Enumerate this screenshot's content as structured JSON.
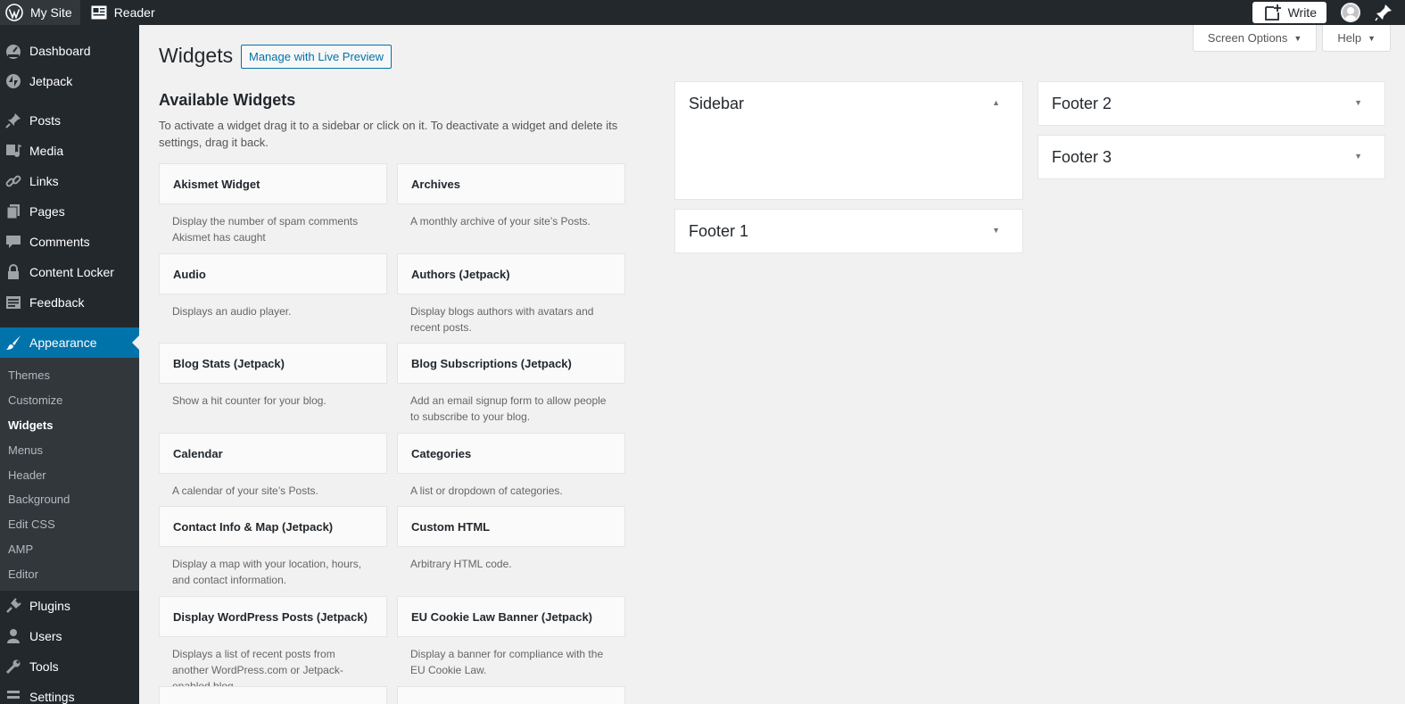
{
  "topbar": {
    "site_label": "My Site",
    "reader_label": "Reader",
    "write_label": "Write"
  },
  "sidebar": {
    "items_top": [
      {
        "label": "Dashboard",
        "icon": "dashboard-icon"
      },
      {
        "label": "Jetpack",
        "icon": "jetpack-icon"
      }
    ],
    "items_mid": [
      {
        "label": "Posts",
        "icon": "pin-icon"
      },
      {
        "label": "Media",
        "icon": "media-icon"
      },
      {
        "label": "Links",
        "icon": "link-icon"
      },
      {
        "label": "Pages",
        "icon": "pages-icon"
      },
      {
        "label": "Comments",
        "icon": "comment-icon"
      },
      {
        "label": "Content Locker",
        "icon": "lock-icon"
      },
      {
        "label": "Feedback",
        "icon": "feedback-icon"
      }
    ],
    "current": {
      "label": "Appearance",
      "icon": "paintbrush-icon"
    },
    "submenu": [
      "Themes",
      "Customize",
      "Widgets",
      "Menus",
      "Header",
      "Background",
      "Edit CSS",
      "AMP",
      "Editor"
    ],
    "submenu_current": "Widgets",
    "items_bottom": [
      {
        "label": "Plugins",
        "icon": "plugin-icon"
      },
      {
        "label": "Users",
        "icon": "user-icon"
      },
      {
        "label": "Tools",
        "icon": "wrench-icon"
      },
      {
        "label": "Settings",
        "icon": "settings-icon"
      }
    ]
  },
  "screen_meta": {
    "screen_options_label": "Screen Options",
    "help_label": "Help"
  },
  "page": {
    "title": "Widgets",
    "live_preview_label": "Manage with Live Preview",
    "available_title": "Available Widgets",
    "available_desc": "To activate a widget drag it to a sidebar or click on it. To deactivate a widget and delete its settings, drag it back."
  },
  "widgets": [
    {
      "title": "Akismet Widget",
      "desc": "Display the number of spam comments Akismet has caught"
    },
    {
      "title": "Archives",
      "desc": "A monthly archive of your site’s Posts."
    },
    {
      "title": "Audio",
      "desc": "Displays an audio player."
    },
    {
      "title": "Authors (Jetpack)",
      "desc": "Display blogs authors with avatars and recent posts."
    },
    {
      "title": "Blog Stats (Jetpack)",
      "desc": "Show a hit counter for your blog."
    },
    {
      "title": "Blog Subscriptions (Jetpack)",
      "desc": "Add an email signup form to allow people to subscribe to your blog."
    },
    {
      "title": "Calendar",
      "desc": "A calendar of your site’s Posts."
    },
    {
      "title": "Categories",
      "desc": "A list or dropdown of categories."
    },
    {
      "title": "Contact Info & Map (Jetpack)",
      "desc": "Display a map with your location, hours, and contact information."
    },
    {
      "title": "Custom HTML",
      "desc": "Arbitrary HTML code."
    },
    {
      "title": "Display WordPress Posts (Jetpack)",
      "desc": "Displays a list of recent posts from another WordPress.com or Jetpack-enabled blog."
    },
    {
      "title": "EU Cookie Law Banner (Jetpack)",
      "desc": "Display a banner for compliance with the EU Cookie Law."
    },
    {
      "title": "",
      "desc": ""
    },
    {
      "title": "",
      "desc": ""
    }
  ],
  "areas": [
    {
      "title": "Sidebar",
      "expanded": true
    },
    {
      "title": "Footer 1",
      "expanded": false
    },
    {
      "title": "Footer 2",
      "expanded": false
    },
    {
      "title": "Footer 3",
      "expanded": false
    }
  ]
}
